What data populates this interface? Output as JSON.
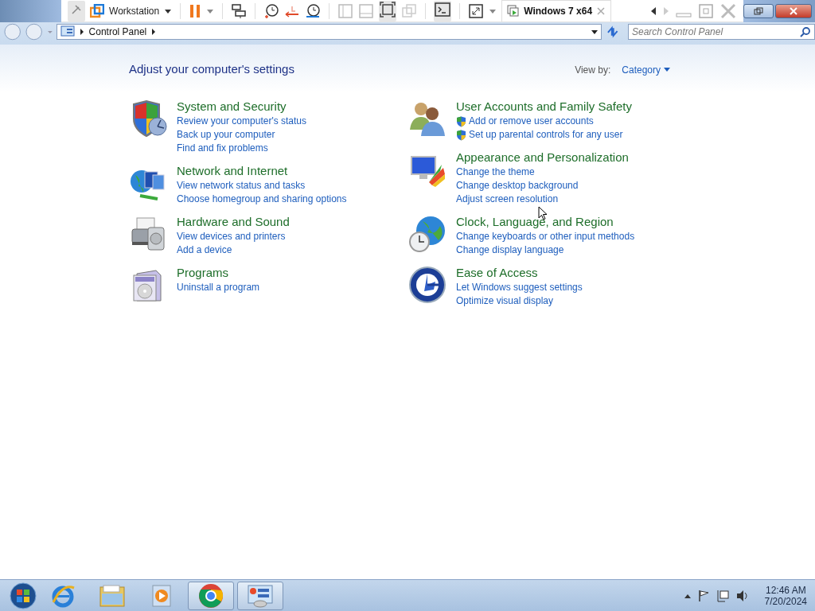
{
  "vm_toolbar": {
    "title": "Workstation",
    "tab": {
      "title": "Windows 7 x64"
    }
  },
  "address_bar": {
    "breadcrumbs": [
      "Control Panel"
    ]
  },
  "search": {
    "placeholder": "Search Control Panel"
  },
  "heading": "Adjust your computer's settings",
  "view_by": {
    "label": "View by:",
    "value": "Category"
  },
  "columns": [
    [
      {
        "title": "System and Security",
        "links": [
          {
            "text": "Review your computer's status",
            "shield": false
          },
          {
            "text": "Back up your computer",
            "shield": false
          },
          {
            "text": "Find and fix problems",
            "shield": false
          }
        ]
      },
      {
        "title": "Network and Internet",
        "links": [
          {
            "text": "View network status and tasks",
            "shield": false
          },
          {
            "text": "Choose homegroup and sharing options",
            "shield": false
          }
        ]
      },
      {
        "title": "Hardware and Sound",
        "links": [
          {
            "text": "View devices and printers",
            "shield": false
          },
          {
            "text": "Add a device",
            "shield": false
          }
        ]
      },
      {
        "title": "Programs",
        "links": [
          {
            "text": "Uninstall a program",
            "shield": false
          }
        ]
      }
    ],
    [
      {
        "title": "User Accounts and Family Safety",
        "links": [
          {
            "text": "Add or remove user accounts",
            "shield": true
          },
          {
            "text": "Set up parental controls for any user",
            "shield": true
          }
        ]
      },
      {
        "title": "Appearance and Personalization",
        "links": [
          {
            "text": "Change the theme",
            "shield": false
          },
          {
            "text": "Change desktop background",
            "shield": false
          },
          {
            "text": "Adjust screen resolution",
            "shield": false
          }
        ]
      },
      {
        "title": "Clock, Language, and Region",
        "links": [
          {
            "text": "Change keyboards or other input methods",
            "shield": false
          },
          {
            "text": "Change display language",
            "shield": false
          }
        ]
      },
      {
        "title": "Ease of Access",
        "links": [
          {
            "text": "Let Windows suggest settings",
            "shield": false
          },
          {
            "text": "Optimize visual display",
            "shield": false
          }
        ]
      }
    ]
  ],
  "taskbar": {
    "apps": [
      {
        "running": false
      },
      {
        "running": false
      },
      {
        "running": false
      },
      {
        "running": true
      },
      {
        "running": true
      }
    ],
    "clock": {
      "time": "12:46 AM",
      "date": "7/20/2024"
    }
  }
}
